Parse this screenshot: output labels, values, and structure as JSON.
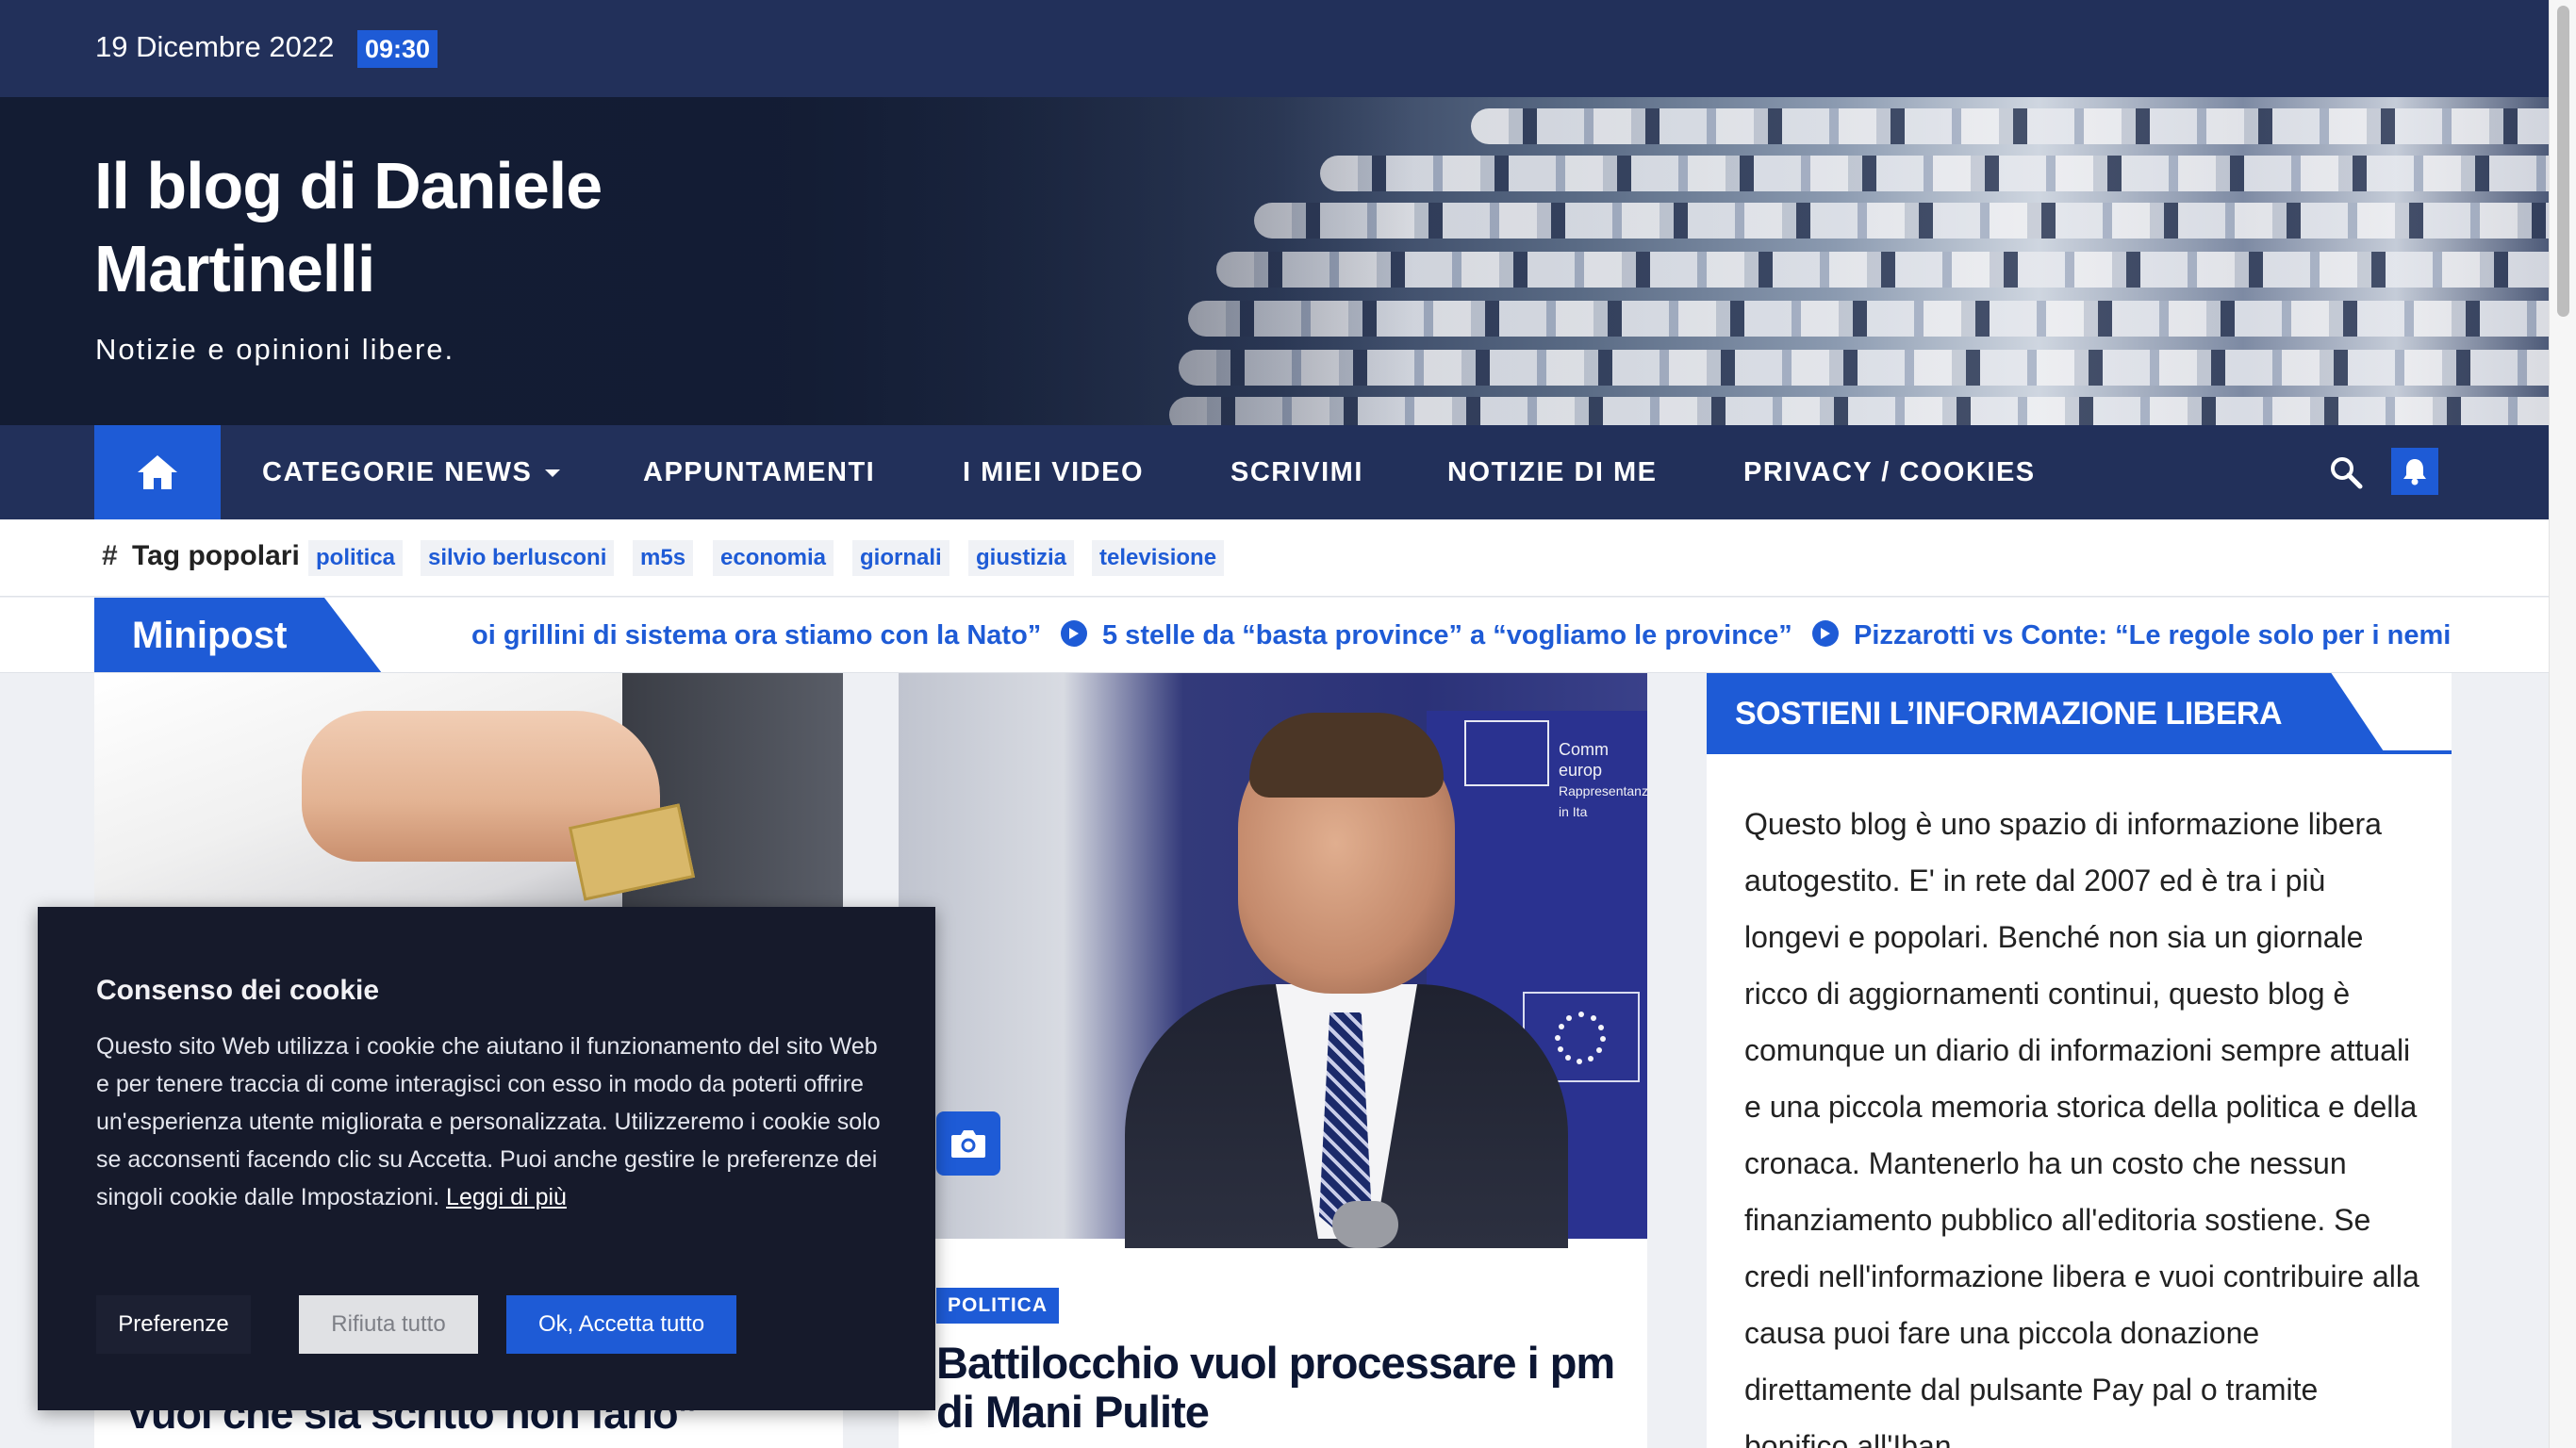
{
  "topbar": {
    "date": "19 Dicembre 2022",
    "time": "09:30"
  },
  "site": {
    "title": "Il blog di Daniele Martinelli",
    "tagline": "Notizie e opinioni libere."
  },
  "nav": {
    "items": [
      {
        "label": "CATEGORIE NEWS"
      },
      {
        "label": "APPUNTAMENTI"
      },
      {
        "label": "I MIEI VIDEO"
      },
      {
        "label": "SCRIVIMI"
      },
      {
        "label": "NOTIZIE DI ME"
      },
      {
        "label": "PRIVACY / COOKIES"
      }
    ],
    "icons": [
      "home-icon",
      "search-icon",
      "bell-icon"
    ]
  },
  "tags": {
    "label": "Tag popolari",
    "items": [
      "politica",
      "silvio berlusconi",
      "m5s",
      "economia",
      "giornali",
      "giustizia",
      "televisione"
    ]
  },
  "ticker": {
    "label": "Minipost",
    "items": [
      "oi grillini di sistema ora stiamo con la Nato”",
      "5 stelle da “basta province” a “vogliamo le province”",
      "Pizzarotti vs Conte: “Le regole solo per i nemici"
    ]
  },
  "posts": [
    {
      "title": "vuol che sia scritto non farlo”"
    },
    {
      "category": "POLITICA",
      "title": "Battilocchio vuol processare i pm di Mani Pulite",
      "photo_caption": [
        "Comm",
        "europ",
        "Rappresentanza in Ita"
      ]
    }
  ],
  "sidebar": {
    "title": "SOSTIENI L’INFORMAZIONE LIBERA",
    "text": "Questo blog è uno spazio di informazione libera autogestito. E' in rete dal 2007 ed è tra i più longevi e popolari. Benché non sia un giornale ricco di aggiornamenti continui, questo blog è comunque un diario di informazioni sempre attuali e una piccola memoria storica della politica e della cronaca. Mantenerlo ha un costo che nessun finanziamento pubblico all'editoria sostiene. Se credi nell'informazione libera e vuoi contribuire alla causa puoi fare una piccola donazione direttamente dal pulsante Pay pal o tramite bonifico all'Iban"
  },
  "cookie": {
    "title": "Consenso dei cookie",
    "text": "Questo sito Web utilizza i cookie che aiutano il funzionamento del sito Web e per tenere traccia di come interagisci con esso in modo da poterti offrire un'esperienza utente migliorata e personalizzata. Utilizzeremo i cookie solo se acconsenti facendo clic su Accetta. Puoi anche gestire le preferenze dei singoli cookie dalle Impostazioni.",
    "link": "Leggi di più",
    "buttons": {
      "preferences": "Preferenze",
      "reject": "Rifiuta tutto",
      "accept": "Ok, Accetta tutto"
    }
  },
  "colors": {
    "navy": "#22305a",
    "accent": "#1e5bd6",
    "cookie_bg": "#161a2b"
  }
}
